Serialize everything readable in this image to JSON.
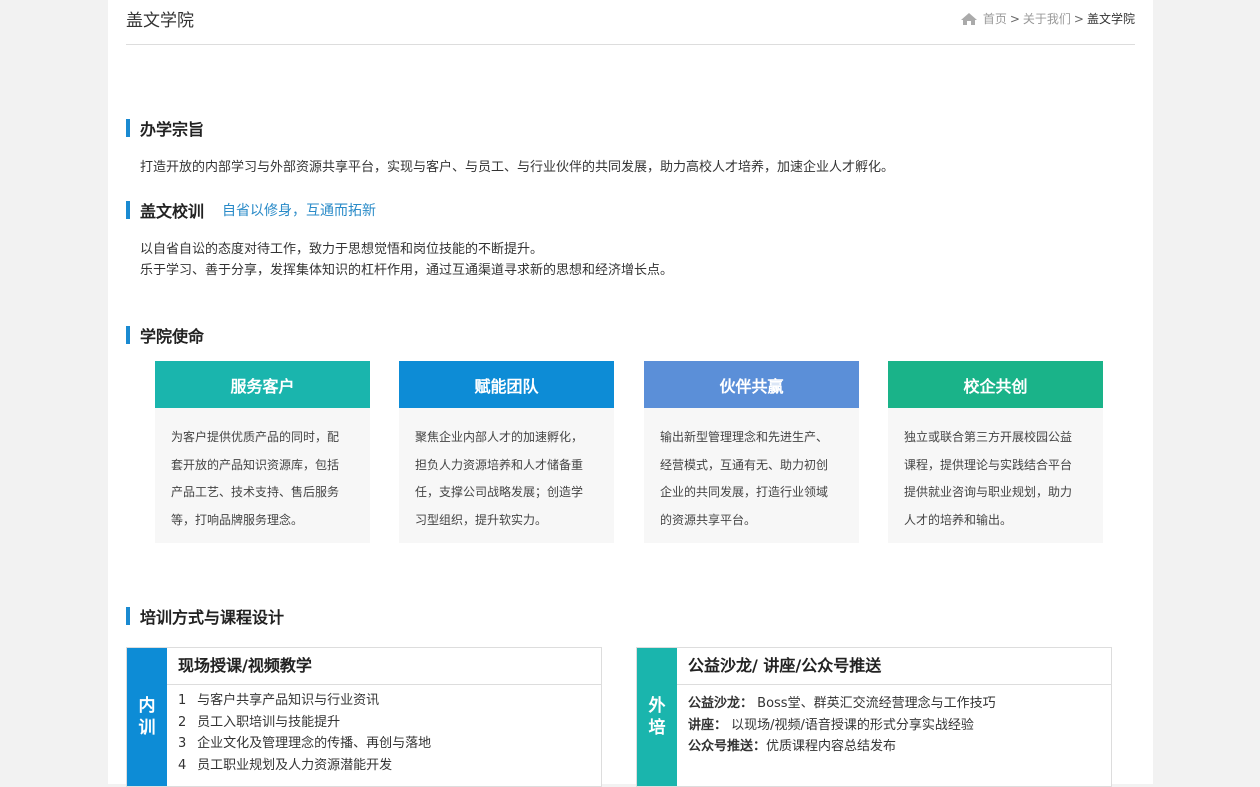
{
  "header": {
    "title": "盖文学院",
    "breadcrumb": [
      {
        "label": "首页"
      },
      {
        "label": "关于我们"
      },
      {
        "label": "盖文学院"
      }
    ],
    "separator": ">"
  },
  "purpose": {
    "title": "办学宗旨",
    "text": "打造开放的内部学习与外部资源共享平台，实现与客户、与员工、与行业伙伴的共同发展，助力高校人才培养，加速企业人才孵化。"
  },
  "motto": {
    "title": "盖文校训",
    "motto": "自省以修身，互通而拓新",
    "lines": [
      "以自省自讼的态度对待工作，致力于思想觉悟和岗位技能的不断提升。",
      "乐于学习、善于分享，发挥集体知识的杠杆作用，通过互通渠道寻求新的思想和经济增长点。"
    ]
  },
  "mission": {
    "title": "学院使命",
    "cards": [
      {
        "title": "服务客户",
        "color": "#1ab5ad",
        "lines": [
          "为客户提供优质产品的同时，配",
          "套开放的产品知识资源库，包括",
          "产品工艺、技术支持、售后服务",
          "等，打响品牌服务理念。"
        ]
      },
      {
        "title": "赋能团队",
        "color": "#0d8cd6",
        "lines": [
          "聚焦企业内部人才的加速孵化，",
          "担负人力资源培养和人才储备重",
          "任，支撑公司战略发展；创造学",
          "习型组织，提升软实力。"
        ]
      },
      {
        "title": "伙伴共赢",
        "color": "#5b8fd8",
        "lines": [
          "输出新型管理理念和先进生产、",
          "经营模式，互通有无、助力初创",
          "企业的共同发展，打造行业领域",
          "的资源共享平台。"
        ]
      },
      {
        "title": "校企共创",
        "color": "#1ab389",
        "lines": [
          "独立或联合第三方开展校园公益",
          "课程，提供理论与实践结合平台",
          "提供就业咨询与职业规划，助力",
          "人才的培养和输出。"
        ]
      }
    ]
  },
  "training": {
    "title": "培训方式与课程设计",
    "internal": {
      "side": [
        "内",
        "训"
      ],
      "side_color": "#0d8cd6",
      "title": "现场授课/视频教学",
      "items": [
        {
          "num": "1",
          "text": "与客户共享产品知识与行业资讯"
        },
        {
          "num": "2",
          "text": "员工入职培训与技能提升"
        },
        {
          "num": "3",
          "text": "企业文化及管理理念的传播、再创与落地"
        },
        {
          "num": "4",
          "text": "员工职业规划及人力资源潜能开发"
        }
      ]
    },
    "external": {
      "side": [
        "外",
        "培"
      ],
      "side_color": "#1ab5ad",
      "title": "公益沙龙/ 讲座/公众号推送",
      "items": [
        {
          "label": "公益沙龙：",
          "text": "Boss堂、群英汇交流经营理念与工作技巧"
        },
        {
          "label": "讲座：",
          "text": "以现场/视频/语音授课的形式分享实战经验"
        },
        {
          "label": "公众号推送：",
          "text": "优质课程内容总结发布"
        }
      ]
    }
  }
}
